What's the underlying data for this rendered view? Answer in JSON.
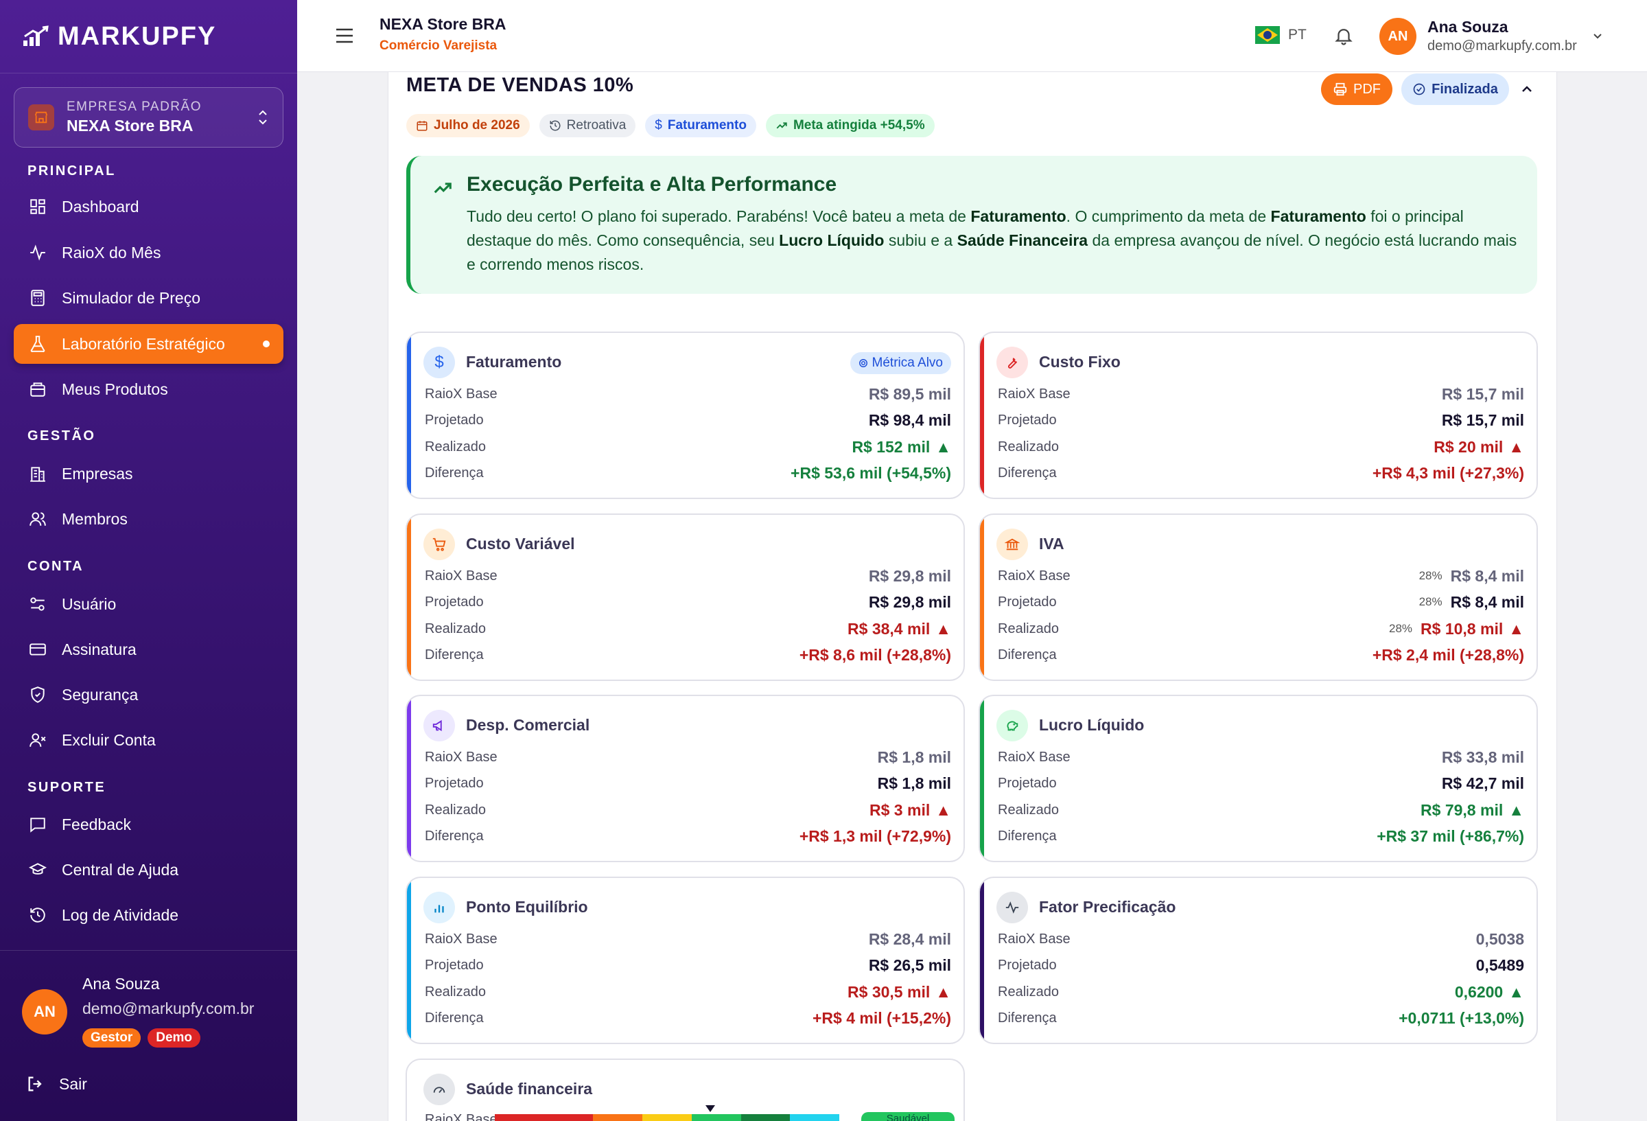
{
  "app": {
    "brand": "MARKUPFY"
  },
  "sidebar": {
    "company_label": "EMPRESA PADRÃO",
    "company_name": "NEXA Store BRA",
    "sections": {
      "principal": "PRINCIPAL",
      "gestao": "GESTÃO",
      "conta": "CONTA",
      "suporte": "SUPORTE"
    },
    "items": {
      "dashboard": "Dashboard",
      "raiox": "RaioX do Mês",
      "simulador": "Simulador de Preço",
      "laboratorio": "Laboratório Estratégico",
      "produtos": "Meus Produtos",
      "empresas": "Empresas",
      "membros": "Membros",
      "usuario": "Usuário",
      "assinatura": "Assinatura",
      "seguranca": "Segurança",
      "excluir": "Excluir Conta",
      "feedback": "Feedback",
      "ajuda": "Central de Ajuda",
      "log": "Log de Atividade"
    },
    "active_item": "Laboratório Estratégico",
    "user": {
      "initials": "AN",
      "name": "Ana Souza",
      "email": "demo@markupfy.com.br",
      "badge_role": "Gestor",
      "badge_demo": "Demo"
    },
    "logout": "Sair"
  },
  "topbar": {
    "store_name": "NEXA Store BRA",
    "store_type": "Comércio Varejista",
    "language": "PT",
    "user": {
      "initials": "AN",
      "name": "Ana Souza",
      "email": "demo@markupfy.com.br"
    }
  },
  "goal": {
    "title": "META DE VENDAS 10%",
    "pdf_label": "PDF",
    "status_label": "Finalizada",
    "tags": {
      "month": "Julho de 2026",
      "mode": "Retroativa",
      "metric": "Faturamento",
      "result": "Meta atingida +54,5%"
    },
    "banner": {
      "title": "Execução Perfeita e Alta Performance",
      "t1": "Tudo deu certo! O plano foi superado. Parabéns! Você bateu a meta de ",
      "b1": "Faturamento",
      "t2": ". O cumprimento da meta de ",
      "b2": "Faturamento",
      "t3": " foi o principal destaque do mês. Como consequência, seu ",
      "b3": "Lucro Líquido",
      "t4": " subiu e a ",
      "b4": "Saúde Financeira",
      "t5": " da empresa avançou de nível. O negócio está lucrando mais e correndo menos riscos."
    }
  },
  "labels": {
    "base": "RaioX Base",
    "projetado": "Projetado",
    "realizado": "Realizado",
    "diferenca": "Diferença",
    "metrica_alvo": "Métrica Alvo"
  },
  "colors": {
    "accent": "#f97316",
    "sidebar": "#3a1576",
    "positive": "#15803d",
    "negative": "#b91c1c"
  },
  "metrics": {
    "faturamento": {
      "title": "Faturamento",
      "icon": "dollar-icon",
      "color": "#2563eb",
      "base": "R$ 89,5 mil",
      "projetado": "R$ 98,4 mil",
      "realizado": "R$ 152 mil",
      "diferenca": "+R$ 53,6 mil (+54,5%)"
    },
    "custo_fixo": {
      "title": "Custo Fixo",
      "icon": "wrench-icon",
      "color": "#dc2626",
      "base": "R$ 15,7 mil",
      "projetado": "R$ 15,7 mil",
      "realizado": "R$ 20 mil",
      "diferenca": "+R$ 4,3 mil (+27,3%)"
    },
    "custo_variavel": {
      "title": "Custo Variável",
      "icon": "cart-icon",
      "color": "#f97316",
      "base": "R$ 29,8 mil",
      "projetado": "R$ 29,8 mil",
      "realizado": "R$ 38,4 mil",
      "diferenca": "+R$ 8,6 mil (+28,8%)"
    },
    "iva": {
      "title": "IVA",
      "icon": "bank-icon",
      "color": "#f97316",
      "pct": "28%",
      "base": "R$ 8,4 mil",
      "projetado": "R$ 8,4 mil",
      "realizado": "R$ 10,8 mil",
      "diferenca": "+R$ 2,4 mil (+28,8%)"
    },
    "desp_comercial": {
      "title": "Desp. Comercial",
      "icon": "megaphone-icon",
      "color": "#7c3aed",
      "base": "R$ 1,8 mil",
      "projetado": "R$ 1,8 mil",
      "realizado": "R$ 3 mil",
      "diferenca": "+R$ 1,3 mil (+72,9%)"
    },
    "lucro_liquido": {
      "title": "Lucro Líquido",
      "icon": "piggy-bank-icon",
      "color": "#16a34a",
      "base": "R$ 33,8 mil",
      "projetado": "R$ 42,7 mil",
      "realizado": "R$ 79,8 mil",
      "diferenca": "+R$ 37 mil (+86,7%)"
    },
    "ponto_equilibrio": {
      "title": "Ponto Equilíbrio",
      "icon": "bar-chart-icon",
      "color": "#0ea5e9",
      "base": "R$ 28,4 mil",
      "projetado": "R$ 26,5 mil",
      "realizado": "R$ 30,5 mil",
      "diferenca": "+R$ 4 mil (+15,2%)"
    },
    "fator_precificacao": {
      "title": "Fator Precificação",
      "icon": "activity-icon",
      "color": "#2e1065",
      "base": "0,5038",
      "projetado": "0,5489",
      "realizado": "0,6200",
      "diferenca": "+0,0711 (+13,0%)"
    },
    "saude": {
      "title": "Saúde financeira",
      "base_label": "RaioX Base",
      "status": "Saudável"
    }
  }
}
